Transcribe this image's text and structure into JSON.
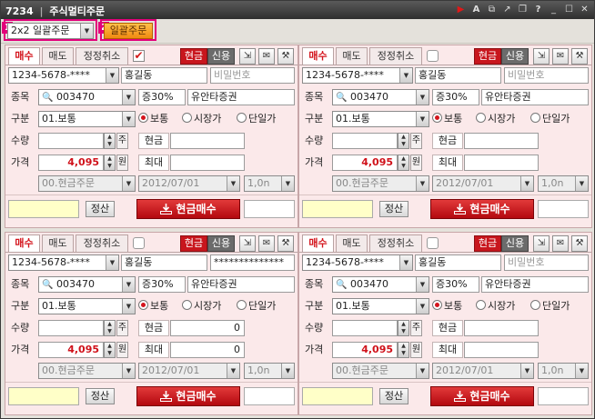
{
  "window": {
    "code": "7234",
    "sep": "|",
    "title": "주식멀티주문"
  },
  "title_icons": [
    "play-icon",
    "font-icon",
    "export-icon",
    "link-icon",
    "restore-icon",
    "help-icon",
    "minimize-icon",
    "maximize-icon",
    "close-icon"
  ],
  "toolbar": {
    "mark1": "1",
    "mark2": "2",
    "layout_value": "2x2 일괄주문",
    "bulk_button": "일괄주문"
  },
  "panels": [
    {
      "tabs": [
        "매수",
        "매도",
        "정정취소"
      ],
      "checked": true,
      "mode_cash": "현금",
      "mode_credit": "신용",
      "account": "1234-5678-****",
      "name": "홍길동",
      "password": "비밀번호",
      "password_is_placeholder": true,
      "code_label": "종목",
      "stock_code": "003470",
      "margin": "증30%",
      "stock_name": "유안타증권",
      "type_label": "구분",
      "type_value": "01.보통",
      "radios": [
        "보통",
        "시장가",
        "단일가"
      ],
      "qty_label": "수량",
      "qty": "",
      "unit_qty": "주",
      "cash_label": "현금",
      "cash_value": "",
      "price_label": "가격",
      "price": "4,095",
      "unit_price": "원",
      "max_label": "최대",
      "max_value": "",
      "order_type": "00.현금주문",
      "date": "2012/07/01",
      "period": "1,0n",
      "calc_button": "정산",
      "buy_button": "현금매수"
    },
    {
      "tabs": [
        "매수",
        "매도",
        "정정취소"
      ],
      "checked": false,
      "mode_cash": "현금",
      "mode_credit": "신용",
      "account": "1234-5678-****",
      "name": "홍길동",
      "password": "비밀번호",
      "password_is_placeholder": true,
      "code_label": "종목",
      "stock_code": "003470",
      "margin": "증30%",
      "stock_name": "유안타증권",
      "type_label": "구분",
      "type_value": "01.보통",
      "radios": [
        "보통",
        "시장가",
        "단일가"
      ],
      "qty_label": "수량",
      "qty": "",
      "unit_qty": "주",
      "cash_label": "현금",
      "cash_value": "",
      "price_label": "가격",
      "price": "4,095",
      "unit_price": "원",
      "max_label": "최대",
      "max_value": "",
      "order_type": "00.현금주문",
      "date": "2012/07/01",
      "period": "1,0n",
      "calc_button": "정산",
      "buy_button": "현금매수"
    },
    {
      "tabs": [
        "매수",
        "매도",
        "정정취소"
      ],
      "checked": false,
      "mode_cash": "현금",
      "mode_credit": "신용",
      "account": "1234-5678-****",
      "name": "홍길동",
      "password": "**************",
      "password_is_placeholder": false,
      "code_label": "종목",
      "stock_code": "003470",
      "margin": "증30%",
      "stock_name": "유안타증권",
      "type_label": "구분",
      "type_value": "01.보통",
      "radios": [
        "보통",
        "시장가",
        "단일가"
      ],
      "qty_label": "수량",
      "qty": "",
      "unit_qty": "주",
      "cash_label": "현금",
      "cash_value": "0",
      "price_label": "가격",
      "price": "4,095",
      "unit_price": "원",
      "max_label": "최대",
      "max_value": "0",
      "order_type": "00.현금주문",
      "date": "2012/07/01",
      "period": "1,0n",
      "calc_button": "정산",
      "buy_button": "현금매수"
    },
    {
      "tabs": [
        "매수",
        "매도",
        "정정취소"
      ],
      "checked": false,
      "mode_cash": "현금",
      "mode_credit": "신용",
      "account": "1234-5678-****",
      "name": "홍길동",
      "password": "비밀번호",
      "password_is_placeholder": true,
      "code_label": "종목",
      "stock_code": "003470",
      "margin": "증30%",
      "stock_name": "유안타증권",
      "type_label": "구분",
      "type_value": "01.보통",
      "radios": [
        "보통",
        "시장가",
        "단일가"
      ],
      "qty_label": "수량",
      "qty": "",
      "unit_qty": "주",
      "cash_label": "현금",
      "cash_value": "",
      "price_label": "가격",
      "price": "4,095",
      "unit_price": "원",
      "max_label": "최대",
      "max_value": "",
      "order_type": "00.현금주문",
      "date": "2012/07/01",
      "period": "1,0n",
      "calc_button": "정산",
      "buy_button": "현금매수"
    }
  ],
  "colors": {
    "accent_red": "#c8161d",
    "panel_bg": "#fbe9ea",
    "highlight": "#e2007a",
    "order_button": "#f08a10"
  }
}
